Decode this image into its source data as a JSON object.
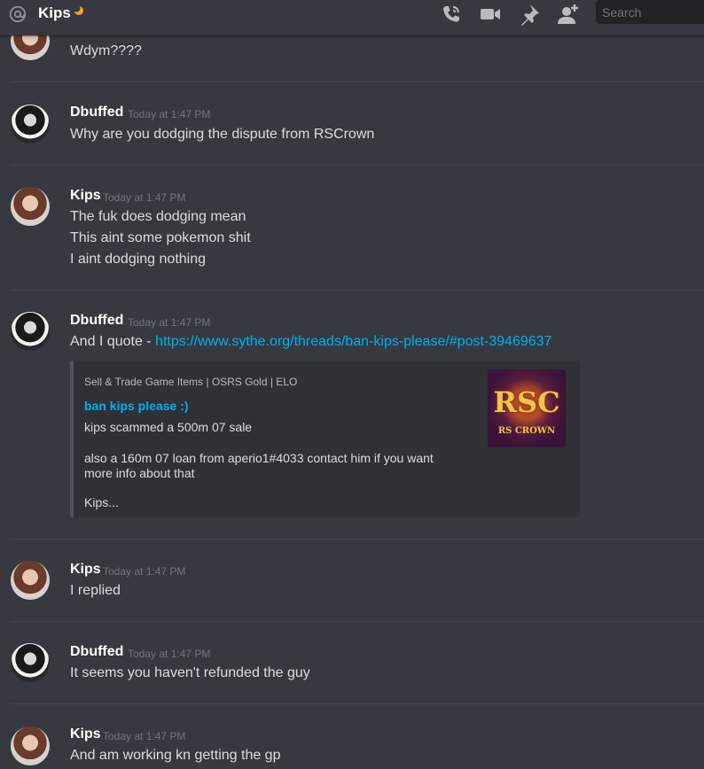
{
  "header": {
    "title": "Kips",
    "search_placeholder": "Search",
    "icons": [
      "at-icon",
      "moon-status-icon",
      "voice-call-icon",
      "video-call-icon",
      "pin-icon",
      "add-friend-icon"
    ]
  },
  "messages": [
    {
      "author": "",
      "timestamp": "",
      "lines": [
        "Wdym????"
      ]
    },
    {
      "author": "Dbuffed",
      "timestamp": "Today at 1:47 PM",
      "lines": [
        "Why are you dodging the dispute from RSCrown"
      ]
    },
    {
      "author": "Kips",
      "timestamp": "Today at 1:47 PM",
      "lines": [
        "The fuk does dodging mean",
        "This aint some pokemon shit",
        "I aint dodging nothing"
      ]
    },
    {
      "author": "Dbuffed",
      "timestamp": "Today at 1:47 PM",
      "text_prefix": "And I quote - ",
      "link": "https://www.sythe.org/threads/ban-kips-please/#post-39469637"
    },
    {
      "author": "Kips",
      "timestamp": "Today at 1:47 PM",
      "lines": [
        "I replied"
      ]
    },
    {
      "author": "Dbuffed",
      "timestamp": "Today at 1:47 PM",
      "lines": [
        "It seems you haven't refunded the guy"
      ]
    },
    {
      "author": "Kips",
      "timestamp": "Today at 1:47 PM",
      "lines": [
        "And am working kn getting the gp"
      ]
    }
  ],
  "embed": {
    "provider": "Sell & Trade Game Items | OSRS Gold | ELO",
    "title": "ban kips please :)",
    "description": [
      "kips scammed a 500m 07 sale",
      "also a 160m 07 loan from aperio1#4033 contact him if you want",
      "more info about that",
      "Kips..."
    ],
    "thumbnail_text": "RSC",
    "thumbnail_subtext": "RS CROWN"
  },
  "colors": {
    "background": "#36393f",
    "link": "#00b0f4",
    "username": "#ffffff",
    "timestamp": "#72767d",
    "embed_bg": "#2f3136"
  }
}
